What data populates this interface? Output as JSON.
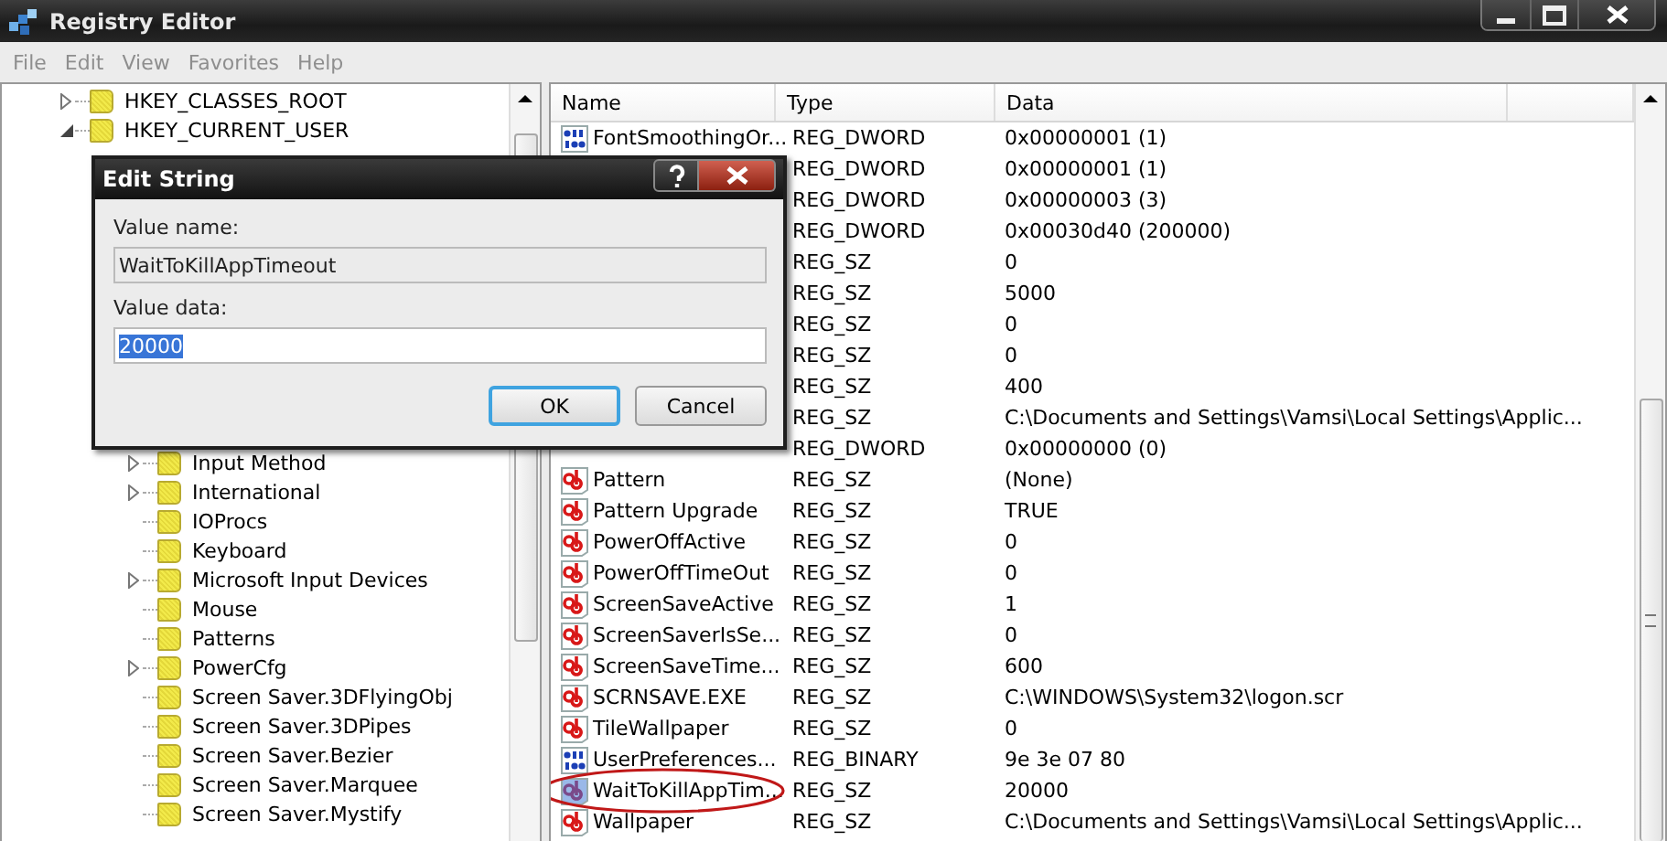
{
  "window": {
    "title": "Registry Editor"
  },
  "menu": [
    {
      "label": "File",
      "disabled": true
    },
    {
      "label": "Edit",
      "disabled": true
    },
    {
      "label": "View",
      "disabled": true
    },
    {
      "label": "Favorites",
      "disabled": true
    },
    {
      "label": "Help",
      "disabled": true
    }
  ],
  "tree": [
    {
      "label": "HKEY_CLASSES_ROOT",
      "expandable": true,
      "expanded": false
    },
    {
      "label": "HKEY_CURRENT_USER",
      "expandable": true,
      "expanded": true,
      "children": [
        {
          "label": "Input Method",
          "expandable": true
        },
        {
          "label": "International",
          "expandable": true
        },
        {
          "label": "IOProcs",
          "expandable": false
        },
        {
          "label": "Keyboard",
          "expandable": false
        },
        {
          "label": "Microsoft Input Devices",
          "expandable": true
        },
        {
          "label": "Mouse",
          "expandable": false
        },
        {
          "label": "Patterns",
          "expandable": false
        },
        {
          "label": "PowerCfg",
          "expandable": true
        },
        {
          "label": "Screen Saver.3DFlyingObj",
          "expandable": false
        },
        {
          "label": "Screen Saver.3DPipes",
          "expandable": false
        },
        {
          "label": "Screen Saver.Bezier",
          "expandable": false
        },
        {
          "label": "Screen Saver.Marquee",
          "expandable": false
        },
        {
          "label": "Screen Saver.Mystify",
          "expandable": false
        }
      ]
    }
  ],
  "list": {
    "columns": [
      "Name",
      "Type",
      "Data"
    ],
    "rows": [
      {
        "kind": "binary",
        "name": "FontSmoothingOr...",
        "type": "REG_DWORD",
        "data": "0x00000001 (1)",
        "selected": false
      },
      {
        "type": "REG_DWORD",
        "data": "0x00000001 (1)"
      },
      {
        "type": "REG_DWORD",
        "data": "0x00000003 (3)"
      },
      {
        "type": "REG_DWORD",
        "data": "0x00030d40 (200000)"
      },
      {
        "type": "REG_SZ",
        "data": "0"
      },
      {
        "type": "REG_SZ",
        "data": "5000"
      },
      {
        "type": "REG_SZ",
        "data": "0"
      },
      {
        "type": "REG_SZ",
        "data": "0"
      },
      {
        "type": "REG_SZ",
        "data": "400"
      },
      {
        "type": "REG_SZ",
        "data": "C:\\Documents and Settings\\Vamsi\\Local Settings\\Applic..."
      },
      {
        "type": "REG_DWORD",
        "data": "0x00000000 (0)"
      },
      {
        "kind": "string",
        "name": "Pattern",
        "type": "REG_SZ",
        "data": "(None)",
        "selected": false
      },
      {
        "kind": "string",
        "name": "Pattern Upgrade",
        "type": "REG_SZ",
        "data": "TRUE",
        "selected": false
      },
      {
        "kind": "string",
        "name": "PowerOffActive",
        "type": "REG_SZ",
        "data": "0",
        "selected": false
      },
      {
        "kind": "string",
        "name": "PowerOffTimeOut",
        "type": "REG_SZ",
        "data": "0",
        "selected": false
      },
      {
        "kind": "string",
        "name": "ScreenSaveActive",
        "type": "REG_SZ",
        "data": "1",
        "selected": false
      },
      {
        "kind": "string",
        "name": "ScreenSaverIsSe...",
        "type": "REG_SZ",
        "data": "0",
        "selected": false
      },
      {
        "kind": "string",
        "name": "ScreenSaveTime...",
        "type": "REG_SZ",
        "data": "600",
        "selected": false
      },
      {
        "kind": "string",
        "name": "SCRNSAVE.EXE",
        "type": "REG_SZ",
        "data": "C:\\WINDOWS\\System32\\logon.scr",
        "selected": false
      },
      {
        "kind": "string",
        "name": "TileWallpaper",
        "type": "REG_SZ",
        "data": "0",
        "selected": false
      },
      {
        "kind": "binary",
        "name": "UserPreferences...",
        "type": "REG_BINARY",
        "data": "9e 3e 07 80",
        "selected": false
      },
      {
        "kind": "string",
        "name": "WaitToKillAppTim...",
        "type": "REG_SZ",
        "data": "20000",
        "selected": true,
        "circled": true
      },
      {
        "kind": "string",
        "name": "Wallpaper",
        "type": "REG_SZ",
        "data": "C:\\Documents and Settings\\Vamsi\\Local Settings\\Applic...",
        "selected": false
      }
    ]
  },
  "dialog": {
    "title": "Edit String",
    "name_label": "Value name:",
    "name_value": "WaitToKillAppTimeout",
    "data_label": "Value data:",
    "data_value": "20000",
    "data_selected": true,
    "buttons": [
      {
        "label": "OK",
        "default": true
      },
      {
        "label": "Cancel",
        "default": false
      }
    ]
  }
}
